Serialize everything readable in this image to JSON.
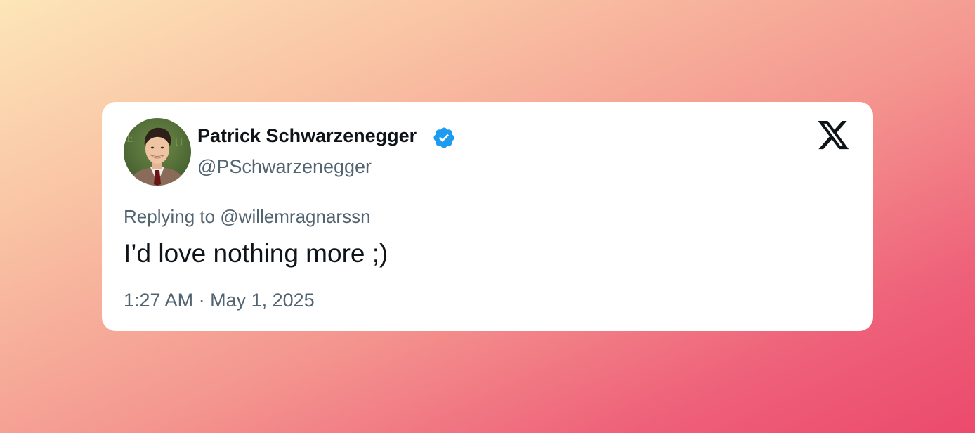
{
  "tweet": {
    "author": {
      "display_name": "Patrick Schwarzenegger",
      "handle": "@PSchwarzenegger",
      "verified": true,
      "verified_icon": "verified-badge-icon",
      "avatar_icon": "profile-photo"
    },
    "reply_to": "Replying to @willemragnarssn",
    "text": "I’d love nothing more ;)",
    "time": "1:27 AM",
    "separator": "·",
    "date": "May 1, 2025"
  },
  "platform": {
    "logo_icon": "x-logo-icon"
  },
  "colors": {
    "card_background": "#ffffff",
    "primary_text": "#0f1419",
    "secondary_text": "#536471",
    "verified_blue": "#1d9bf0",
    "gradient_start": "#fde6b8",
    "gradient_end": "#ec4a6c"
  }
}
